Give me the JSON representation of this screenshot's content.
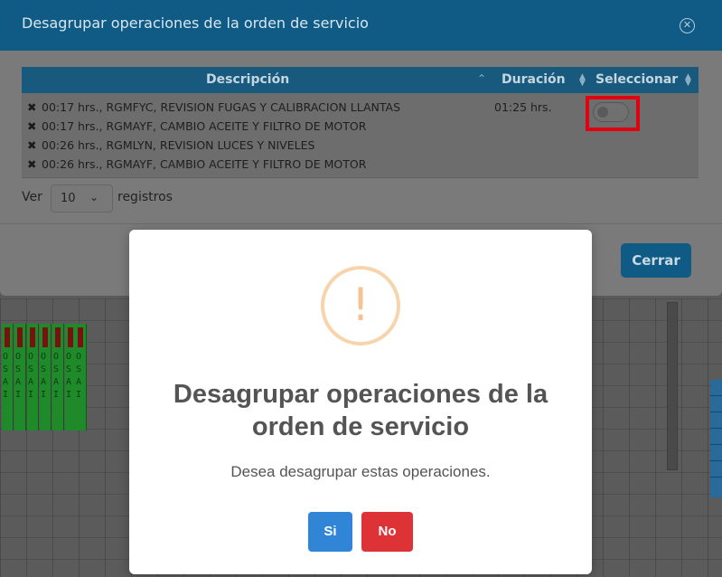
{
  "modal": {
    "title": "Desagrupar operaciones de la orden de servicio",
    "close_icon": "close-circle-icon",
    "table": {
      "headers": {
        "description": "Descripción",
        "duration": "Duración",
        "select": "Seleccionar"
      },
      "row": {
        "operations": [
          "00:17 hrs., RGMFYC, REVISION FUGAS Y CALIBRACION LLANTAS",
          "00:17 hrs., RGMAYF, CAMBIO ACEITE Y FILTRO DE MOTOR",
          "00:26 hrs., RGMLYN, REVISION LUCES Y NIVELES",
          "00:26 hrs., RGMAYF, CAMBIO ACEITE Y FILTRO DE MOTOR"
        ],
        "duration": "01:25 hrs.",
        "selected": false
      }
    },
    "length": {
      "prefix": "Ver",
      "value": "10",
      "suffix": "registros"
    },
    "close_button": "Cerrar"
  },
  "dialog": {
    "icon": "warning-icon",
    "icon_glyph": "!",
    "title": "Desagrupar operaciones de la orden de servicio",
    "text": "Desea desagrupar estas operaciones.",
    "confirm": "Si",
    "cancel": "No",
    "colors": {
      "confirm": "#3085d6",
      "cancel": "#dd3336",
      "warning": "#f8bb86"
    }
  }
}
